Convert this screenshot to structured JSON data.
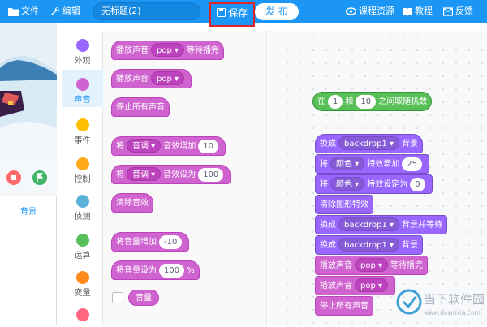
{
  "topbar": {
    "file_label": "文件",
    "edit_label": "编辑",
    "project_title": "无标题(2)",
    "save_label": "保存",
    "publish_label": "发 布",
    "course_label": "课程资源",
    "tutorial_label": "教程",
    "feedback_label": "反馈"
  },
  "stage": {
    "backdrop_label": "背景"
  },
  "categories": [
    {
      "label": "外观",
      "color": "#9966ff"
    },
    {
      "label": "声音",
      "color": "#cf63cf",
      "active": true
    },
    {
      "label": "事件",
      "color": "#ffbf00"
    },
    {
      "label": "控制",
      "color": "#ffab19"
    },
    {
      "label": "侦测",
      "color": "#5cb1d6"
    },
    {
      "label": "运算",
      "color": "#59c059"
    },
    {
      "label": "变量",
      "color": "#ff8c1a"
    }
  ],
  "palette": {
    "play_until_done": {
      "prefix": "播放声音",
      "sound": "pop",
      "suffix": "等待播完"
    },
    "start_sound": {
      "prefix": "播放声音",
      "sound": "pop"
    },
    "stop_all": "停止所有声音",
    "change_effect": {
      "prefix": "将",
      "effect": "音调",
      "suffix": "音效增加",
      "value": "10"
    },
    "set_effect": {
      "prefix": "将",
      "effect": "音调",
      "suffix": "音效设为",
      "value": "100"
    },
    "clear_effects": "清除音效",
    "change_volume": {
      "prefix": "将音量增加",
      "value": "-10"
    },
    "set_volume": {
      "prefix": "将音量设为",
      "value": "100",
      "unit": "%"
    },
    "volume_reporter": "音量"
  },
  "workspace": {
    "random": {
      "prefix": "在",
      "from": "1",
      "mid": "和",
      "to": "10",
      "suffix": "之间取随机数"
    },
    "switch_backdrop": {
      "prefix": "换成",
      "backdrop": "backdrop1",
      "suffix": "背景"
    },
    "change_effect": {
      "prefix": "将",
      "effect": "颜色",
      "suffix": "特效增加",
      "value": "25"
    },
    "set_effect": {
      "prefix": "将",
      "effect": "颜色",
      "suffix": "特效设定为",
      "value": "0"
    },
    "clear_graphic": "清除图形特效",
    "switch_backdrop_wait": {
      "prefix": "换成",
      "backdrop": "backdrop1",
      "suffix": "背景并等待"
    },
    "switch_backdrop2": {
      "prefix": "换成",
      "backdrop": "backdrop1",
      "suffix": "背景"
    },
    "play_until_done": {
      "prefix": "播放声音",
      "sound": "pop",
      "suffix": "等待播完"
    },
    "start_sound": {
      "prefix": "播放声音",
      "sound": "pop"
    },
    "stop_all": "停止所有声音"
  },
  "watermark": {
    "site_name": "当下软件园",
    "url": "www.downxia.com"
  }
}
